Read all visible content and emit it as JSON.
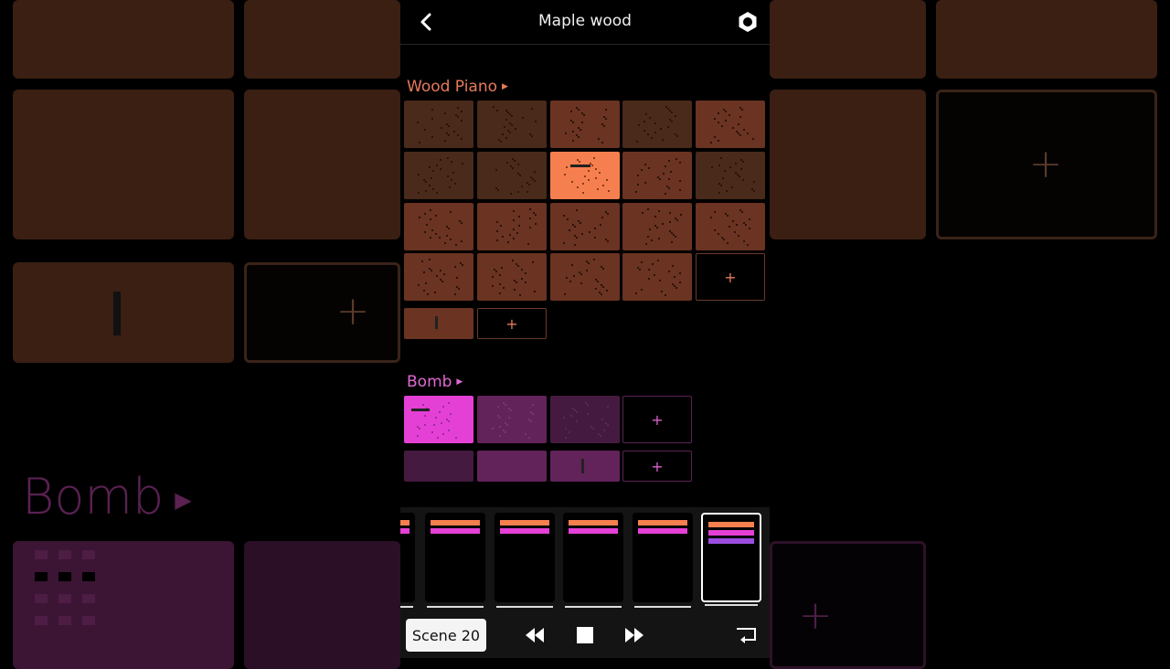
{
  "header": {
    "title": "Maple wood"
  },
  "icons": {
    "back": "chevron-left-icon",
    "settings": "gear-icon"
  },
  "tracks": [
    {
      "name": "Wood Piano",
      "color": "#e67b5a"
    },
    {
      "name": "Bomb",
      "color": "#e069d2"
    }
  ],
  "add_label": "+",
  "background": {
    "title": "Bomb",
    "add_label": "+"
  },
  "scenes_strip": {
    "count_visible": 6,
    "selected_index": 5
  },
  "transport": {
    "scene_label": "Scene 20",
    "rewind": "rewind-icon",
    "stop": "stop-icon",
    "fast_forward": "fast-forward-icon",
    "record_return": "return-icon"
  }
}
